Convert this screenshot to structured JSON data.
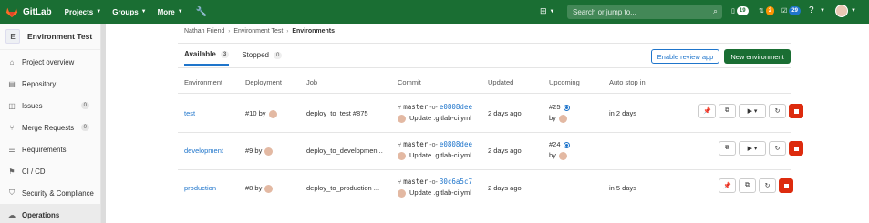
{
  "navbar": {
    "brand": "GitLab",
    "menus": [
      "Projects",
      "Groups",
      "More"
    ],
    "search_placeholder": "Search or jump to...",
    "counters": {
      "merge_requests": "19",
      "issues": "2",
      "todos": "29"
    }
  },
  "sidebar": {
    "project_initial": "E",
    "project_name": "Environment Test",
    "items": [
      {
        "label": "Project overview",
        "icon": "home-icon"
      },
      {
        "label": "Repository",
        "icon": "doc-icon"
      },
      {
        "label": "Issues",
        "icon": "issues-icon",
        "count": "0"
      },
      {
        "label": "Merge Requests",
        "icon": "merge-icon",
        "count": "0"
      },
      {
        "label": "Requirements",
        "icon": "list-icon"
      },
      {
        "label": "CI / CD",
        "icon": "rocket-icon"
      },
      {
        "label": "Security & Compliance",
        "icon": "shield-icon"
      },
      {
        "label": "Operations",
        "icon": "cloud-icon"
      }
    ]
  },
  "breadcrumb": {
    "a": "Nathan Friend",
    "b": "Environment Test",
    "c": "Environments"
  },
  "tabs": [
    {
      "label": "Available",
      "count": "3"
    },
    {
      "label": "Stopped",
      "count": "0"
    }
  ],
  "buttons": {
    "review": "Enable review app",
    "new_env": "New environment"
  },
  "headers": {
    "environment": "Environment",
    "deployment": "Deployment",
    "job": "Job",
    "commit": "Commit",
    "updated": "Updated",
    "upcoming": "Upcoming",
    "autostop": "Auto stop in"
  },
  "rows": [
    {
      "env": "test",
      "deploy": "#10 by",
      "job": "deploy_to_test #875",
      "branch": "master",
      "sha": "e0808dee",
      "msg": "Update .gitlab-ci.yml",
      "updated": "2 days ago",
      "upcoming": "#25",
      "upcoming_by": "by",
      "autostop": "in 2 days"
    },
    {
      "env": "development",
      "deploy": "#9 by",
      "job": "deploy_to_developmen...",
      "branch": "master",
      "sha": "e0808dee",
      "msg": "Update .gitlab-ci.yml",
      "updated": "2 days ago",
      "upcoming": "#24",
      "upcoming_by": "by",
      "autostop": ""
    },
    {
      "env": "production",
      "deploy": "#8 by",
      "job": "deploy_to_production ...",
      "branch": "master",
      "sha": "30c6a5c7",
      "msg": "Update .gitlab-ci.yml",
      "updated": "2 days ago",
      "upcoming": "",
      "upcoming_by": "",
      "autostop": "in 5 days"
    }
  ]
}
